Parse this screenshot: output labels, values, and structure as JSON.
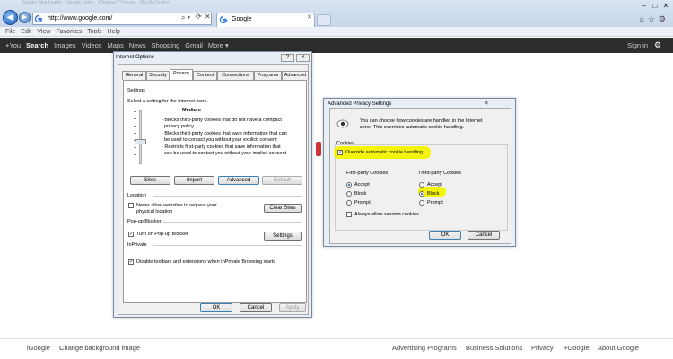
{
  "browser": {
    "background_tabs": "Google Blue header · Update Users · Windows 7 Forums · Mozilla Firefox",
    "address": "http://www.google.com/",
    "tab_title": "Google",
    "menu": [
      "File",
      "Edit",
      "View",
      "Favorites",
      "Tools",
      "Help"
    ]
  },
  "gbar": {
    "items": [
      "+You",
      "Search",
      "Images",
      "Videos",
      "Maps",
      "News",
      "Shopping",
      "Gmail",
      "More ▾"
    ],
    "signin": "Sign in"
  },
  "footer": {
    "left": [
      "iGoogle",
      "Change background image"
    ],
    "right": [
      "Advertising Programs",
      "Business Solutions",
      "Privacy",
      "+Google",
      "About Google"
    ]
  },
  "internet_options": {
    "title": "Internet Options",
    "tabs": [
      "General",
      "Security",
      "Privacy",
      "Content",
      "Connections",
      "Programs",
      "Advanced"
    ],
    "settings_label": "Settings",
    "zone_text": "Select a setting for the Internet zone.",
    "level": "Medium",
    "description": [
      "- Blocks third-party cookies that do not have a compact",
      "privacy policy",
      "- Blocks third-party cookies that save information that can",
      "be used to contact you without your explicit consent",
      "- Restricts first-party cookies that save information that",
      "can be used to contact you without your implicit consent"
    ],
    "buttons": {
      "sites": "Sites",
      "import": "Import",
      "advanced": "Advanced",
      "default": "Default"
    },
    "location_label": "Location",
    "location_check": [
      "Never allow websites to request your",
      "physical location"
    ],
    "clear_sites": "Clear Sites",
    "popup_label": "Pop-up Blocker",
    "popup_check": "Turn on Pop-up Blocker",
    "popup_settings": "Settings",
    "inprivate_label": "InPrivate",
    "inprivate_check": "Disable toolbars and extensions when InPrivate Browsing starts",
    "ok": "OK",
    "cancel": "Cancel",
    "apply": "Apply"
  },
  "advanced_privacy": {
    "title": "Advanced Privacy Settings",
    "intro": [
      "You can choose how cookies are handled in the Internet",
      "zone.  This overrides automatic cookie handling."
    ],
    "cookies_label": "Cookies",
    "override": "Override automatic cookie handling",
    "first_party": {
      "label": "First-party Cookies",
      "options": [
        "Accept",
        "Block",
        "Prompt"
      ],
      "selected": "Accept"
    },
    "third_party": {
      "label": "Third-party Cookies",
      "options": [
        "Accept",
        "Block",
        "Prompt"
      ],
      "selected": "Block"
    },
    "session": "Always allow session cookies",
    "ok": "OK",
    "cancel": "Cancel"
  }
}
